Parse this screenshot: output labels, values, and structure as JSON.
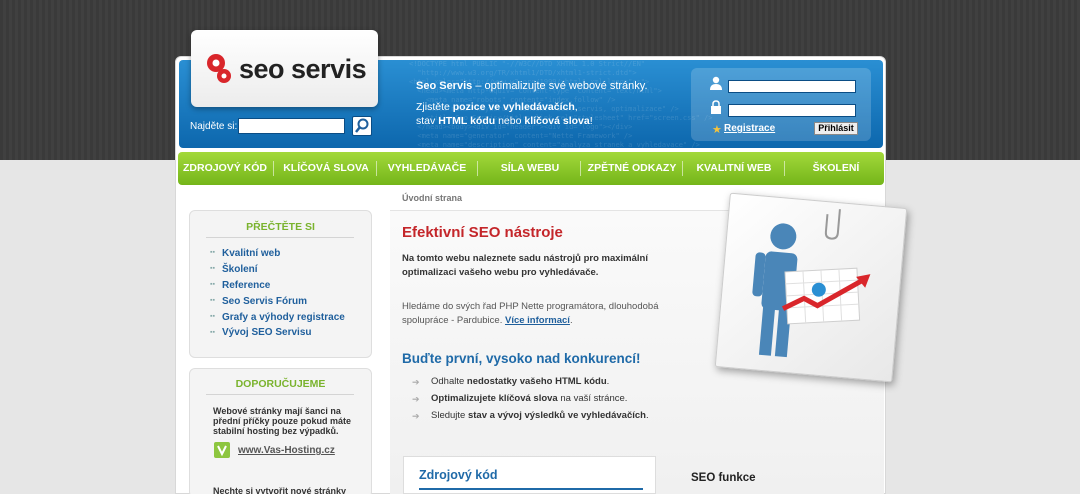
{
  "brand": {
    "logo_text": "seo servis",
    "accent_blue": "#1f6aa8",
    "accent_green": "#7ab32d",
    "accent_red": "#c4262a"
  },
  "header": {
    "search_label": "Najděte si:",
    "search_value": "",
    "tagline_strong": "Seo Servis",
    "tagline_rest": " – optimalizujte své webové stránky.",
    "line1_a": "Zjistěte ",
    "line1_b": "pozice ve vyhledávačích",
    "line1_c": ",",
    "line2_a": "stav ",
    "line2_b": "HTML kódu",
    "line2_c": " nebo ",
    "line2_d": "klíčová slova",
    "line2_e": "!"
  },
  "login": {
    "register": "Registrace",
    "submit": "Přihlásit"
  },
  "nav": [
    "ZDROJOVÝ KÓD",
    "KLÍČOVÁ SLOVA",
    "VYHLEDÁVAČE",
    "SÍLA WEBU",
    "ZPĚTNÉ ODKAZY",
    "KVALITNÍ WEB",
    "ŠKOLENÍ"
  ],
  "sidebar": {
    "read_title": "PŘEČTĚTE SI",
    "read_links": [
      "Kvalitní web",
      "Školení",
      "Reference",
      "Seo Servis Fórum",
      "Grafy a výhody registrace",
      "Vývoj SEO Servisu"
    ],
    "recommend_title": "DOPORUČUJEME",
    "recommend_text": "Webové stránky mají šanci na přední příčky pouze pokud máte stabilní hosting bez výpadků.",
    "recommend_link": "www.Vas-Hosting.cz",
    "recommend_text2": "Nechte si vytvořit nové stránky"
  },
  "main": {
    "breadcrumb": "Úvodní strana",
    "title": "Efektivní SEO nástroje",
    "intro": "Na tomto webu naleznete sadu nástrojů pro maximální optimalizaci vašeho webu pro vyhledávače.",
    "hiring_text": "Hledáme do svých řad PHP Nette programátora, dlouhodobá spolupráce - Pardubice.",
    "hiring_link": "Více informací",
    "subtitle": "Buďte první, vysoko nad konkurencí!",
    "features": [
      {
        "a": "Odhalte ",
        "b": "nedostatky vašeho HTML kódu",
        "c": "."
      },
      {
        "a": "",
        "b": "Optimalizujete klíčová slova",
        "c": " na vaší stránce."
      },
      {
        "a": "Sledujte ",
        "b": "stav a vývoj výsledků ve vyhledávačích",
        "c": "."
      }
    ],
    "code_box_title": "Zdrojový kód",
    "seo_funkce": "SEO funkce"
  }
}
